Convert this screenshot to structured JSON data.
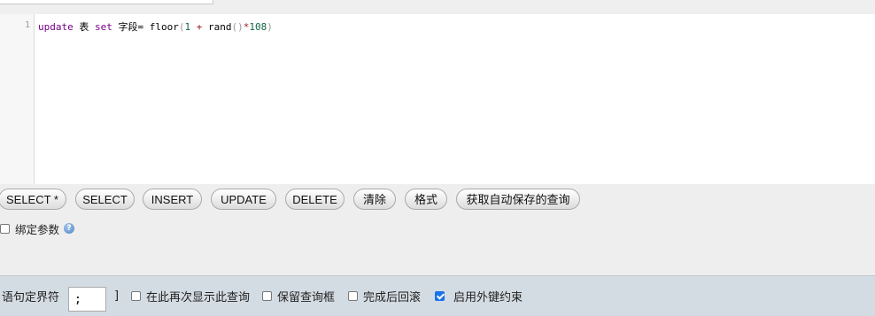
{
  "editor": {
    "line_number": "1",
    "code": {
      "t1": "update",
      "t2": " 表 ",
      "t3": "set",
      "t4": " 字段= floor",
      "t5": "(",
      "t6": "1",
      "t7": " + ",
      "t8": "rand",
      "t9": "()",
      "t10": "*",
      "t11": "108",
      "t12": ")"
    }
  },
  "buttons": {
    "select_star": "SELECT *",
    "select": "SELECT",
    "insert": "INSERT",
    "update": "UPDATE",
    "delete": "DELETE",
    "clear": "清除",
    "format": "格式",
    "get_autosave": "获取自动保存的查询"
  },
  "bind_params": {
    "label": "绑定参数",
    "checked": false,
    "help_icon": "help-icon"
  },
  "footer": {
    "delimiter_label": "语句定界符",
    "delimiter_value": ";",
    "delimiter_close": "]",
    "options": [
      {
        "label": "在此再次显示此查询",
        "checked": false
      },
      {
        "label": "保留查询框",
        "checked": false
      },
      {
        "label": "完成后回滚",
        "checked": false
      },
      {
        "label": "启用外键约束",
        "checked": true
      }
    ]
  },
  "colors": {
    "keyword": "#770088",
    "number": "#116644",
    "operator": "#981a1a",
    "checkbox_checked": "#1a73e8",
    "footer_bg": "#d4dce3"
  }
}
